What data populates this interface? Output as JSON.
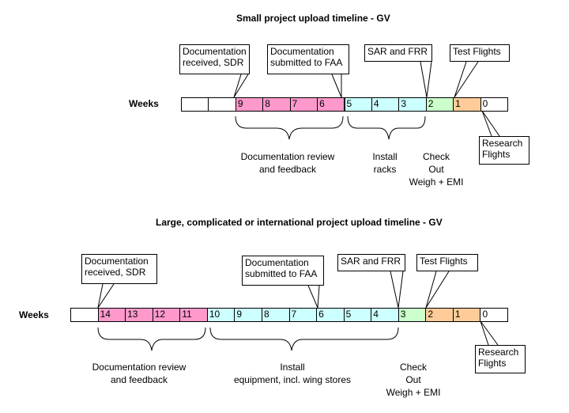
{
  "colors": {
    "blank": "#ffffff",
    "pink": "#ff99cc",
    "cyan": "#ccffff",
    "green": "#ccffcc",
    "orange": "#ffcc99"
  },
  "small": {
    "title": "Small project upload timeline - GV",
    "weeks_label": "Weeks",
    "cells": [
      {
        "text": "",
        "color": "blank"
      },
      {
        "text": "",
        "color": "blank"
      },
      {
        "text": "9",
        "color": "pink"
      },
      {
        "text": "8",
        "color": "pink"
      },
      {
        "text": "7",
        "color": "pink"
      },
      {
        "text": "6",
        "color": "pink"
      },
      {
        "text": "5",
        "color": "cyan"
      },
      {
        "text": "4",
        "color": "cyan"
      },
      {
        "text": "3",
        "color": "cyan"
      },
      {
        "text": "2",
        "color": "green"
      },
      {
        "text": "1",
        "color": "orange"
      },
      {
        "text": "0",
        "color": "blank"
      }
    ],
    "callouts": [
      {
        "lines": [
          "Documentation",
          "received, SDR"
        ]
      },
      {
        "lines": [
          "Documentation",
          "submitted to FAA"
        ]
      },
      {
        "lines": [
          "SAR and FRR"
        ]
      },
      {
        "lines": [
          "Test Flights"
        ]
      },
      {
        "lines": [
          "Research",
          "Flights"
        ]
      }
    ],
    "phases": [
      {
        "lines": [
          "Documentation review",
          "and feedback"
        ]
      },
      {
        "lines": [
          "Install",
          "racks"
        ]
      },
      {
        "lines": [
          "Check",
          "Out",
          "Weigh + EMI"
        ]
      }
    ]
  },
  "large": {
    "title": "Large, complicated or international project upload timeline - GV",
    "weeks_label": "Weeks",
    "cells": [
      {
        "text": "",
        "color": "blank"
      },
      {
        "text": "14",
        "color": "pink"
      },
      {
        "text": "13",
        "color": "pink"
      },
      {
        "text": "12",
        "color": "pink"
      },
      {
        "text": "11",
        "color": "pink"
      },
      {
        "text": "10",
        "color": "cyan"
      },
      {
        "text": "9",
        "color": "cyan"
      },
      {
        "text": "8",
        "color": "cyan"
      },
      {
        "text": "7",
        "color": "cyan"
      },
      {
        "text": "6",
        "color": "cyan"
      },
      {
        "text": "5",
        "color": "cyan"
      },
      {
        "text": "4",
        "color": "cyan"
      },
      {
        "text": "3",
        "color": "green"
      },
      {
        "text": "2",
        "color": "orange"
      },
      {
        "text": "1",
        "color": "orange"
      },
      {
        "text": "0",
        "color": "blank"
      }
    ],
    "callouts": [
      {
        "lines": [
          "Documentation",
          "received, SDR"
        ]
      },
      {
        "lines": [
          "Documentation",
          "submitted to FAA"
        ]
      },
      {
        "lines": [
          "SAR and FRR"
        ]
      },
      {
        "lines": [
          "Test Flights"
        ]
      },
      {
        "lines": [
          "Research",
          "Flights"
        ]
      }
    ],
    "phases": [
      {
        "lines": [
          "Documentation review",
          "and feedback"
        ]
      },
      {
        "lines": [
          "Install",
          "equipment, incl. wing stores"
        ]
      },
      {
        "lines": [
          "Check",
          "Out",
          "Weigh + EMI"
        ]
      }
    ]
  }
}
